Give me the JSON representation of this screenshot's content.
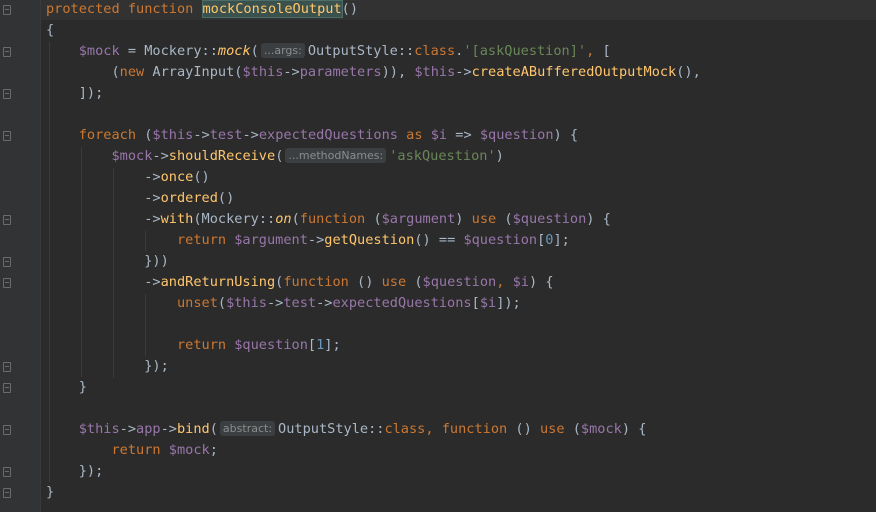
{
  "editor": {
    "colors": {
      "background": "#2b2b2b",
      "keyword": "#cc7832",
      "function": "#ffc66d",
      "variable": "#9876aa",
      "string": "#6a8759",
      "number": "#6897bb",
      "text": "#a9b7c6"
    },
    "lines": [
      {
        "indent": 0,
        "tokens": [
          {
            "t": "protected function ",
            "c": "kw"
          },
          {
            "t": "mockConsoleOutput",
            "c": "fn",
            "hl": true
          },
          {
            "t": "()",
            "c": "punct"
          }
        ]
      },
      {
        "indent": 0,
        "tokens": [
          {
            "t": "{",
            "c": "punct"
          }
        ]
      },
      {
        "indent": 1,
        "tokens": [
          {
            "t": "$mock",
            "c": "var"
          },
          {
            "t": " = ",
            "c": "op"
          },
          {
            "t": "Mockery",
            "c": "class"
          },
          {
            "t": "::",
            "c": "op"
          },
          {
            "t": "mock",
            "c": "static"
          },
          {
            "t": "(",
            "c": "punct"
          },
          {
            "hint": "...args:"
          },
          {
            "t": "OutputStyle",
            "c": "class"
          },
          {
            "t": "::",
            "c": "op"
          },
          {
            "t": "class",
            "c": "kw"
          },
          {
            "t": ".",
            "c": "op"
          },
          {
            "t": "'[askQuestion]'",
            "c": "str"
          },
          {
            "t": ", ",
            "c": "comma"
          },
          {
            "t": "[",
            "c": "punct"
          }
        ]
      },
      {
        "indent": 2,
        "tokens": [
          {
            "t": "(",
            "c": "punct"
          },
          {
            "t": "new ",
            "c": "kw"
          },
          {
            "t": "ArrayInput",
            "c": "class"
          },
          {
            "t": "(",
            "c": "punct"
          },
          {
            "t": "$this",
            "c": "var"
          },
          {
            "t": "->",
            "c": "op"
          },
          {
            "t": "parameters",
            "c": "prop"
          },
          {
            "t": ")), ",
            "c": "punct"
          },
          {
            "t": "$this",
            "c": "var"
          },
          {
            "t": "->",
            "c": "op"
          },
          {
            "t": "createABufferedOutputMock",
            "c": "fn"
          },
          {
            "t": "(),",
            "c": "punct"
          }
        ]
      },
      {
        "indent": 1,
        "tokens": [
          {
            "t": "]);",
            "c": "punct"
          }
        ]
      },
      {
        "indent": 0,
        "tokens": []
      },
      {
        "indent": 1,
        "tokens": [
          {
            "t": "foreach ",
            "c": "kw"
          },
          {
            "t": "(",
            "c": "punct"
          },
          {
            "t": "$this",
            "c": "var"
          },
          {
            "t": "->",
            "c": "op"
          },
          {
            "t": "test",
            "c": "prop"
          },
          {
            "t": "->",
            "c": "op"
          },
          {
            "t": "expectedQuestions",
            "c": "prop"
          },
          {
            "t": " as ",
            "c": "kw"
          },
          {
            "t": "$i",
            "c": "var"
          },
          {
            "t": " => ",
            "c": "op"
          },
          {
            "t": "$question",
            "c": "var"
          },
          {
            "t": ") {",
            "c": "punct"
          }
        ]
      },
      {
        "indent": 2,
        "tokens": [
          {
            "t": "$mock",
            "c": "var"
          },
          {
            "t": "->",
            "c": "op"
          },
          {
            "t": "shouldReceive",
            "c": "fn"
          },
          {
            "t": "(",
            "c": "punct"
          },
          {
            "hint": "...methodNames:"
          },
          {
            "t": "'askQuestion'",
            "c": "str"
          },
          {
            "t": ")",
            "c": "punct"
          }
        ]
      },
      {
        "indent": 3,
        "tokens": [
          {
            "t": "->",
            "c": "op"
          },
          {
            "t": "once",
            "c": "fn"
          },
          {
            "t": "()",
            "c": "punct"
          }
        ]
      },
      {
        "indent": 3,
        "tokens": [
          {
            "t": "->",
            "c": "op"
          },
          {
            "t": "ordered",
            "c": "fn"
          },
          {
            "t": "()",
            "c": "punct"
          }
        ]
      },
      {
        "indent": 3,
        "tokens": [
          {
            "t": "->",
            "c": "op"
          },
          {
            "t": "with",
            "c": "fn"
          },
          {
            "t": "(",
            "c": "punct"
          },
          {
            "t": "Mockery",
            "c": "class"
          },
          {
            "t": "::",
            "c": "op"
          },
          {
            "t": "on",
            "c": "static"
          },
          {
            "t": "(",
            "c": "punct"
          },
          {
            "t": "function ",
            "c": "kw"
          },
          {
            "t": "(",
            "c": "punct"
          },
          {
            "t": "$argument",
            "c": "var"
          },
          {
            "t": ") ",
            "c": "punct"
          },
          {
            "t": "use ",
            "c": "kw"
          },
          {
            "t": "(",
            "c": "punct"
          },
          {
            "t": "$question",
            "c": "var"
          },
          {
            "t": ") {",
            "c": "punct"
          }
        ]
      },
      {
        "indent": 4,
        "tokens": [
          {
            "t": "return ",
            "c": "kw"
          },
          {
            "t": "$argument",
            "c": "var"
          },
          {
            "t": "->",
            "c": "op"
          },
          {
            "t": "getQuestion",
            "c": "fn"
          },
          {
            "t": "() == ",
            "c": "punct"
          },
          {
            "t": "$question",
            "c": "var"
          },
          {
            "t": "[",
            "c": "punct"
          },
          {
            "t": "0",
            "c": "num"
          },
          {
            "t": "];",
            "c": "punct"
          }
        ]
      },
      {
        "indent": 3,
        "tokens": [
          {
            "t": "}))",
            "c": "punct"
          }
        ]
      },
      {
        "indent": 3,
        "tokens": [
          {
            "t": "->",
            "c": "op"
          },
          {
            "t": "andReturnUsing",
            "c": "fn"
          },
          {
            "t": "(",
            "c": "punct"
          },
          {
            "t": "function ",
            "c": "kw"
          },
          {
            "t": "() ",
            "c": "punct"
          },
          {
            "t": "use ",
            "c": "kw"
          },
          {
            "t": "(",
            "c": "punct"
          },
          {
            "t": "$question",
            "c": "var"
          },
          {
            "t": ", ",
            "c": "comma"
          },
          {
            "t": "$i",
            "c": "var"
          },
          {
            "t": ") {",
            "c": "punct"
          }
        ]
      },
      {
        "indent": 4,
        "tokens": [
          {
            "t": "unset",
            "c": "kw"
          },
          {
            "t": "(",
            "c": "punct"
          },
          {
            "t": "$this",
            "c": "var"
          },
          {
            "t": "->",
            "c": "op"
          },
          {
            "t": "test",
            "c": "prop"
          },
          {
            "t": "->",
            "c": "op"
          },
          {
            "t": "expectedQuestions",
            "c": "prop"
          },
          {
            "t": "[",
            "c": "punct"
          },
          {
            "t": "$i",
            "c": "var"
          },
          {
            "t": "]);",
            "c": "punct"
          }
        ]
      },
      {
        "indent": 0,
        "tokens": []
      },
      {
        "indent": 4,
        "tokens": [
          {
            "t": "return ",
            "c": "kw"
          },
          {
            "t": "$question",
            "c": "var"
          },
          {
            "t": "[",
            "c": "punct"
          },
          {
            "t": "1",
            "c": "num"
          },
          {
            "t": "];",
            "c": "punct"
          }
        ]
      },
      {
        "indent": 3,
        "tokens": [
          {
            "t": "});",
            "c": "punct"
          }
        ]
      },
      {
        "indent": 1,
        "tokens": [
          {
            "t": "}",
            "c": "punct"
          }
        ]
      },
      {
        "indent": 0,
        "tokens": []
      },
      {
        "indent": 1,
        "tokens": [
          {
            "t": "$this",
            "c": "var"
          },
          {
            "t": "->",
            "c": "op"
          },
          {
            "t": "app",
            "c": "prop"
          },
          {
            "t": "->",
            "c": "op"
          },
          {
            "t": "bind",
            "c": "fn"
          },
          {
            "t": "(",
            "c": "punct"
          },
          {
            "hint": "abstract:"
          },
          {
            "t": "OutputStyle",
            "c": "class"
          },
          {
            "t": "::",
            "c": "op"
          },
          {
            "t": "class",
            "c": "kw"
          },
          {
            "t": ", ",
            "c": "comma"
          },
          {
            "t": "function ",
            "c": "kw"
          },
          {
            "t": "() ",
            "c": "punct"
          },
          {
            "t": "use ",
            "c": "kw"
          },
          {
            "t": "(",
            "c": "punct"
          },
          {
            "t": "$mock",
            "c": "var"
          },
          {
            "t": ") {",
            "c": "punct"
          }
        ]
      },
      {
        "indent": 2,
        "tokens": [
          {
            "t": "return ",
            "c": "kw"
          },
          {
            "t": "$mock",
            "c": "var"
          },
          {
            "t": ";",
            "c": "punct"
          }
        ]
      },
      {
        "indent": 1,
        "tokens": [
          {
            "t": "});",
            "c": "punct"
          }
        ]
      },
      {
        "indent": 0,
        "tokens": [
          {
            "t": "}",
            "c": "punct"
          }
        ]
      }
    ]
  }
}
